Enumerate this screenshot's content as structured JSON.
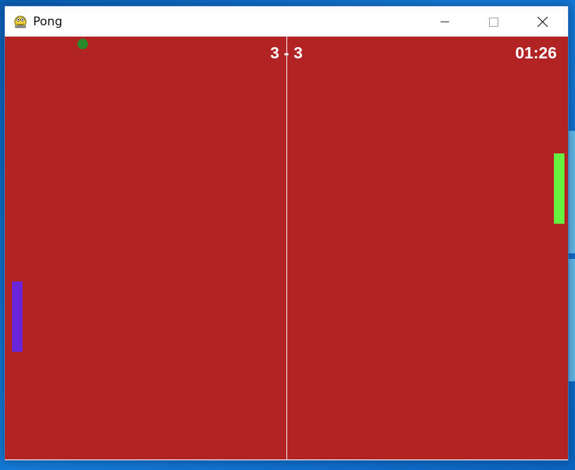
{
  "window": {
    "title": "Pong",
    "icon": "pygame-snake-icon",
    "controls": {
      "minimize_icon": "minimize-icon",
      "maximize_icon": "maximize-icon",
      "close_icon": "close-icon"
    }
  },
  "game": {
    "score": "3 - 3",
    "timer": "01:26",
    "colors": {
      "background": "#b22424",
      "center_line": "#ffffff",
      "ball": "#2a8a2a",
      "left_paddle": "#6a24d8",
      "right_paddle": "#66f040",
      "text": "#ffffff"
    }
  }
}
